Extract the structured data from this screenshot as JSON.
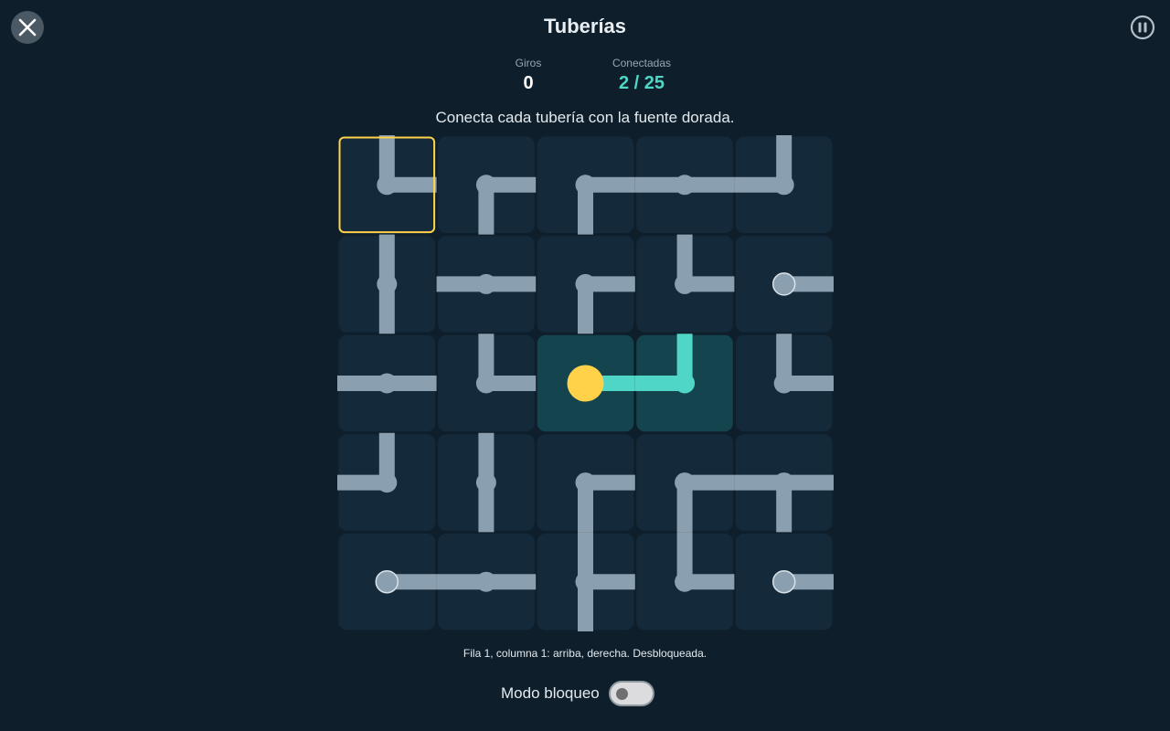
{
  "header": {
    "title": "Tuberías",
    "close_icon": "close-icon",
    "pause_icon": "pause-icon"
  },
  "stats": {
    "turns_label": "Giros",
    "turns_value": "0",
    "connected_label": "Conectadas",
    "connected_value": "2 / 25"
  },
  "instructions": "Conecta cada tubería con la fuente dorada.",
  "board": {
    "rows": 5,
    "cols": 5,
    "selected": [
      0,
      0
    ],
    "colors": {
      "tile": "#14293a",
      "tile_connected": "#14444e",
      "pipe": "#8aa0b0",
      "pipe_connected": "#4fd6c6",
      "source": "#ffd24a",
      "selection": "#ffd24a"
    },
    "tiles": [
      [
        {
          "dirs": [
            "up",
            "right"
          ],
          "connected": false
        },
        {
          "dirs": [
            "right",
            "down"
          ],
          "connected": false
        },
        {
          "dirs": [
            "right",
            "down"
          ],
          "connected": false
        },
        {
          "dirs": [
            "left",
            "right"
          ],
          "connected": false
        },
        {
          "dirs": [
            "up",
            "left"
          ],
          "connected": false
        }
      ],
      [
        {
          "dirs": [
            "up",
            "down"
          ],
          "connected": false
        },
        {
          "dirs": [
            "left",
            "right"
          ],
          "connected": false
        },
        {
          "dirs": [
            "right",
            "down"
          ],
          "connected": false
        },
        {
          "dirs": [
            "up",
            "right"
          ],
          "connected": false
        },
        {
          "dirs": [
            "right"
          ],
          "end": true,
          "connected": false
        }
      ],
      [
        {
          "dirs": [
            "left",
            "right"
          ],
          "connected": false
        },
        {
          "dirs": [
            "up",
            "right"
          ],
          "connected": false
        },
        {
          "dirs": [
            "right"
          ],
          "source": true,
          "connected": true
        },
        {
          "dirs": [
            "up",
            "left"
          ],
          "connected": true
        },
        {
          "dirs": [
            "up",
            "right"
          ],
          "connected": false
        }
      ],
      [
        {
          "dirs": [
            "up",
            "left"
          ],
          "connected": false
        },
        {
          "dirs": [
            "up",
            "down"
          ],
          "connected": false
        },
        {
          "dirs": [
            "right",
            "down"
          ],
          "connected": false
        },
        {
          "dirs": [
            "right",
            "down"
          ],
          "connected": false
        },
        {
          "dirs": [
            "left",
            "right",
            "down"
          ],
          "connected": false
        }
      ],
      [
        {
          "dirs": [
            "right"
          ],
          "end": true,
          "connected": false
        },
        {
          "dirs": [
            "left",
            "right"
          ],
          "connected": false
        },
        {
          "dirs": [
            "up",
            "right",
            "down"
          ],
          "connected": false
        },
        {
          "dirs": [
            "up",
            "right"
          ],
          "connected": false
        },
        {
          "dirs": [
            "right"
          ],
          "end": true,
          "connected": false
        }
      ]
    ]
  },
  "status_line": "Fila 1, columna 1: arriba, derecha. Desbloqueada.",
  "lock_mode": {
    "label": "Modo bloqueo",
    "enabled": false
  }
}
